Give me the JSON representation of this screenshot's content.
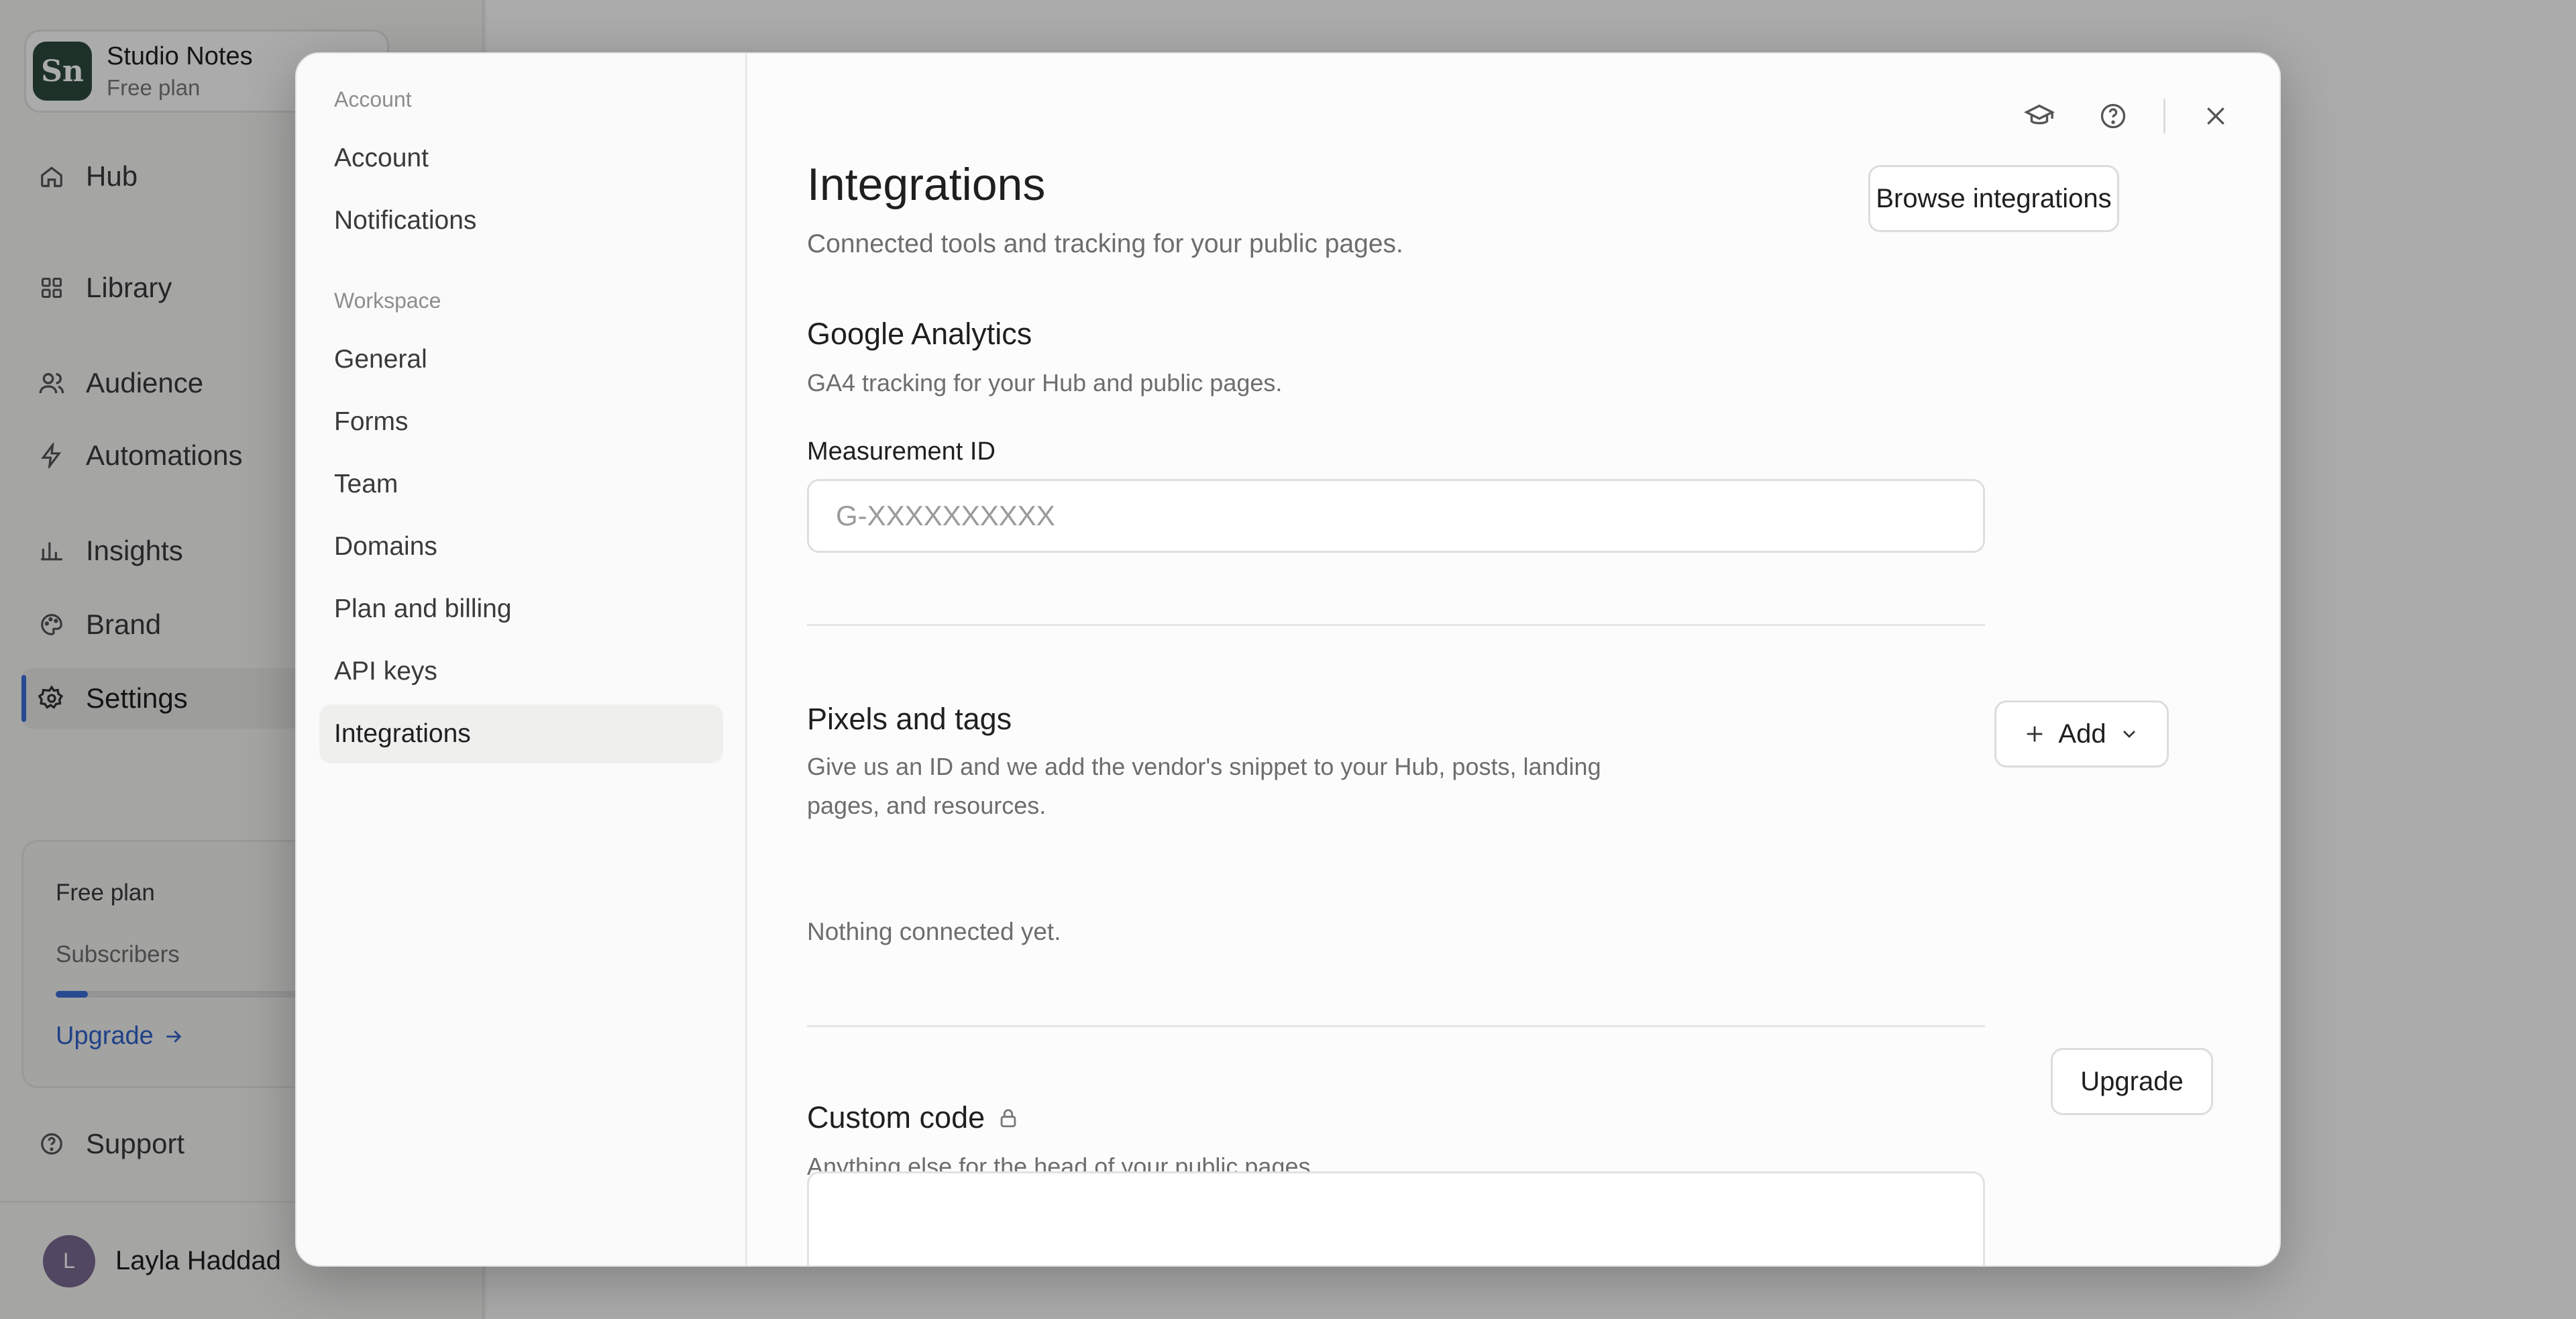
{
  "workspace": {
    "logo": "Sn",
    "name": "Studio Notes",
    "plan": "Free plan"
  },
  "app_nav": [
    {
      "label": "Hub",
      "icon": "home-icon"
    },
    {
      "label": "Library",
      "icon": "grid-icon"
    },
    {
      "label": "Audience",
      "icon": "users-icon"
    },
    {
      "label": "Automations",
      "icon": "bolt-icon"
    },
    {
      "label": "Insights",
      "icon": "bar-chart-icon"
    },
    {
      "label": "Brand",
      "icon": "palette-icon"
    },
    {
      "label": "Settings",
      "icon": "gear-icon",
      "active": true
    }
  ],
  "plan_card": {
    "title": "Free plan",
    "subscribers_label": "Subscribers",
    "subscribers_progress": 0.1,
    "upgrade_label": "Upgrade"
  },
  "support_label": "Support",
  "user": {
    "initial": "L",
    "name": "Layla Haddad"
  },
  "settings_nav": {
    "account_section": "Account",
    "account_items": [
      "Account",
      "Notifications"
    ],
    "workspace_section": "Workspace",
    "workspace_items": [
      "General",
      "Forms",
      "Team",
      "Domains",
      "Plan and billing",
      "API keys",
      "Integrations"
    ],
    "active_item": "Integrations"
  },
  "page": {
    "title": "Integrations",
    "subtitle": "Connected tools and tracking for your public pages.",
    "browse_button": "Browse integrations"
  },
  "google_analytics": {
    "title": "Google Analytics",
    "subtitle": "GA4 tracking for your Hub and public pages.",
    "field_label": "Measurement ID",
    "placeholder": "G-XXXXXXXXXX",
    "value": ""
  },
  "pixels": {
    "title": "Pixels and tags",
    "subtitle_line1": "Give us an ID and we add the vendor's snippet to your Hub, posts, landing",
    "subtitle_line2": "pages, and resources.",
    "add_button": "Add",
    "empty_text": "Nothing connected yet."
  },
  "custom_code": {
    "title": "Custom code",
    "subtitle": "Anything else for the head of your public pages.",
    "upgrade_button": "Upgrade"
  },
  "colors": {
    "accent": "#3b6fd9",
    "brand": "#2c4a3e",
    "avatar": "#7a6b93"
  }
}
